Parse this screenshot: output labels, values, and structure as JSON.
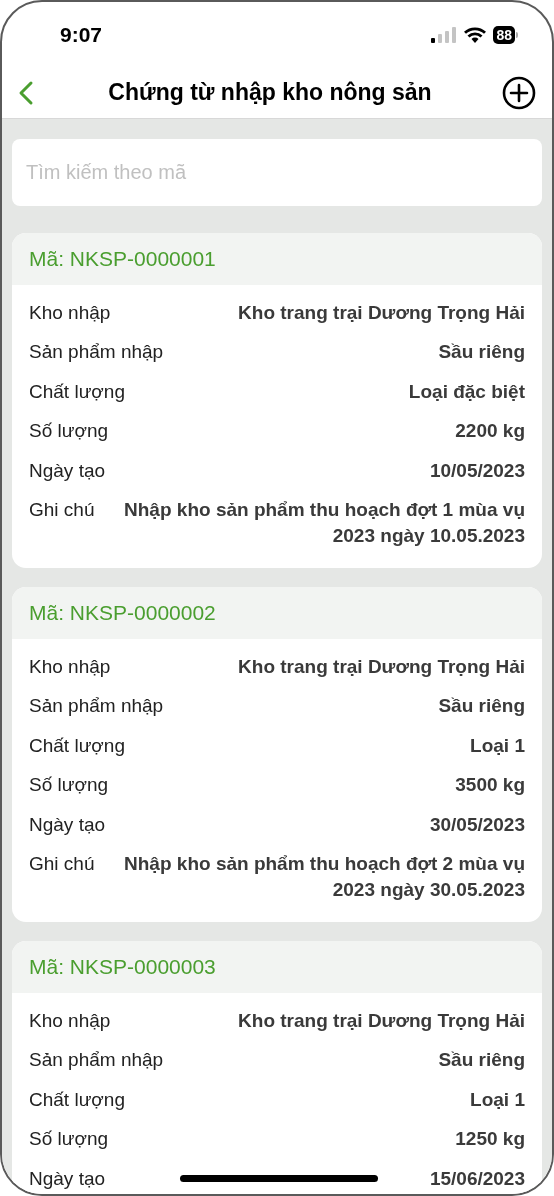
{
  "status_bar": {
    "time": "9:07",
    "battery": "88"
  },
  "nav": {
    "title": "Chứng từ nhập kho nông sản"
  },
  "search": {
    "placeholder": "Tìm kiếm theo mã"
  },
  "records": [
    {
      "code": "Mã: NKSP-0000001",
      "fields": [
        {
          "label": "Kho nhập",
          "value": "Kho trang trại Dương Trọng Hải"
        },
        {
          "label": "Sản phẩm nhập",
          "value": "Sầu riêng"
        },
        {
          "label": "Chất lượng",
          "value": "Loại đặc biệt"
        },
        {
          "label": "Số lượng",
          "value": "2200 kg"
        },
        {
          "label": "Ngày tạo",
          "value": "10/05/2023"
        },
        {
          "label": "Ghi chú",
          "value": "Nhập kho sản phẩm thu hoạch đợt 1 mùa vụ 2023 ngày 10.05.2023"
        }
      ]
    },
    {
      "code": "Mã: NKSP-0000002",
      "fields": [
        {
          "label": "Kho nhập",
          "value": "Kho trang trại Dương Trọng Hải"
        },
        {
          "label": "Sản phẩm nhập",
          "value": "Sầu riêng"
        },
        {
          "label": "Chất lượng",
          "value": "Loại 1"
        },
        {
          "label": "Số lượng",
          "value": "3500 kg"
        },
        {
          "label": "Ngày tạo",
          "value": "30/05/2023"
        },
        {
          "label": "Ghi chú",
          "value": "Nhập kho sản phẩm thu hoạch đợt 2 mùa vụ 2023 ngày 30.05.2023"
        }
      ]
    },
    {
      "code": "Mã: NKSP-0000003",
      "fields": [
        {
          "label": "Kho nhập",
          "value": "Kho trang trại Dương Trọng Hải"
        },
        {
          "label": "Sản phẩm nhập",
          "value": "Sầu riêng"
        },
        {
          "label": "Chất lượng",
          "value": "Loại 1"
        },
        {
          "label": "Số lượng",
          "value": "1250 kg"
        },
        {
          "label": "Ngày tạo",
          "value": "15/06/2023"
        }
      ]
    }
  ]
}
